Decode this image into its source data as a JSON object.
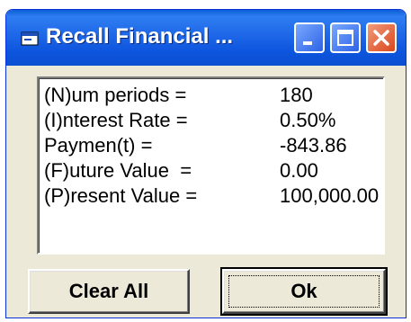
{
  "window": {
    "title": "Recall Financial ...",
    "icon": "app-icon",
    "controls": [
      "minimize-icon",
      "maximize-icon",
      "close-icon"
    ]
  },
  "rows": [
    {
      "label": "(N)um periods =",
      "value": "180"
    },
    {
      "label": "(I)nterest Rate =",
      "value": "0.50%"
    },
    {
      "label": "Paymen(t) =",
      "value": "-843.86"
    },
    {
      "label": "(F)uture Value  =",
      "value": "0.00"
    },
    {
      "label": "(P)resent Value =",
      "value": "100,000.00"
    }
  ],
  "buttons": {
    "clear_all": "Clear All",
    "ok": "Ok"
  },
  "colors": {
    "titlebar": "#0b4fd1",
    "close_button": "#d9481d",
    "window_bg": "#ece9d8"
  }
}
